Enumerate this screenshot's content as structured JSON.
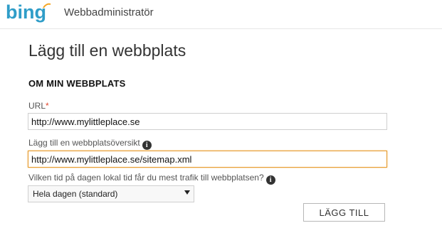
{
  "header": {
    "logo_text": "bing",
    "app_title": "Webbadministratör"
  },
  "page": {
    "title": "Lägg till en webbplats",
    "section_title": "OM MIN WEBBPLATS"
  },
  "form": {
    "url_label": "URL",
    "url_required_mark": "*",
    "url_value": "http://www.mylittleplace.se",
    "sitemap_label": "Lägg till en webbplatsöversikt",
    "sitemap_value": "http://www.mylittleplace.se/sitemap.xml",
    "traffic_label": "Vilken tid på dagen lokal tid får du mest trafik till webbplatsen?",
    "traffic_selected": "Hela dagen (standard)",
    "submit_label": "LÄGG TILL"
  },
  "colors": {
    "brand": "#2f9dc8",
    "focus_border": "#e69a2b",
    "required": "#e0462c"
  },
  "icons": {
    "info": "info-icon",
    "dropdown": "chevron-down-icon"
  }
}
